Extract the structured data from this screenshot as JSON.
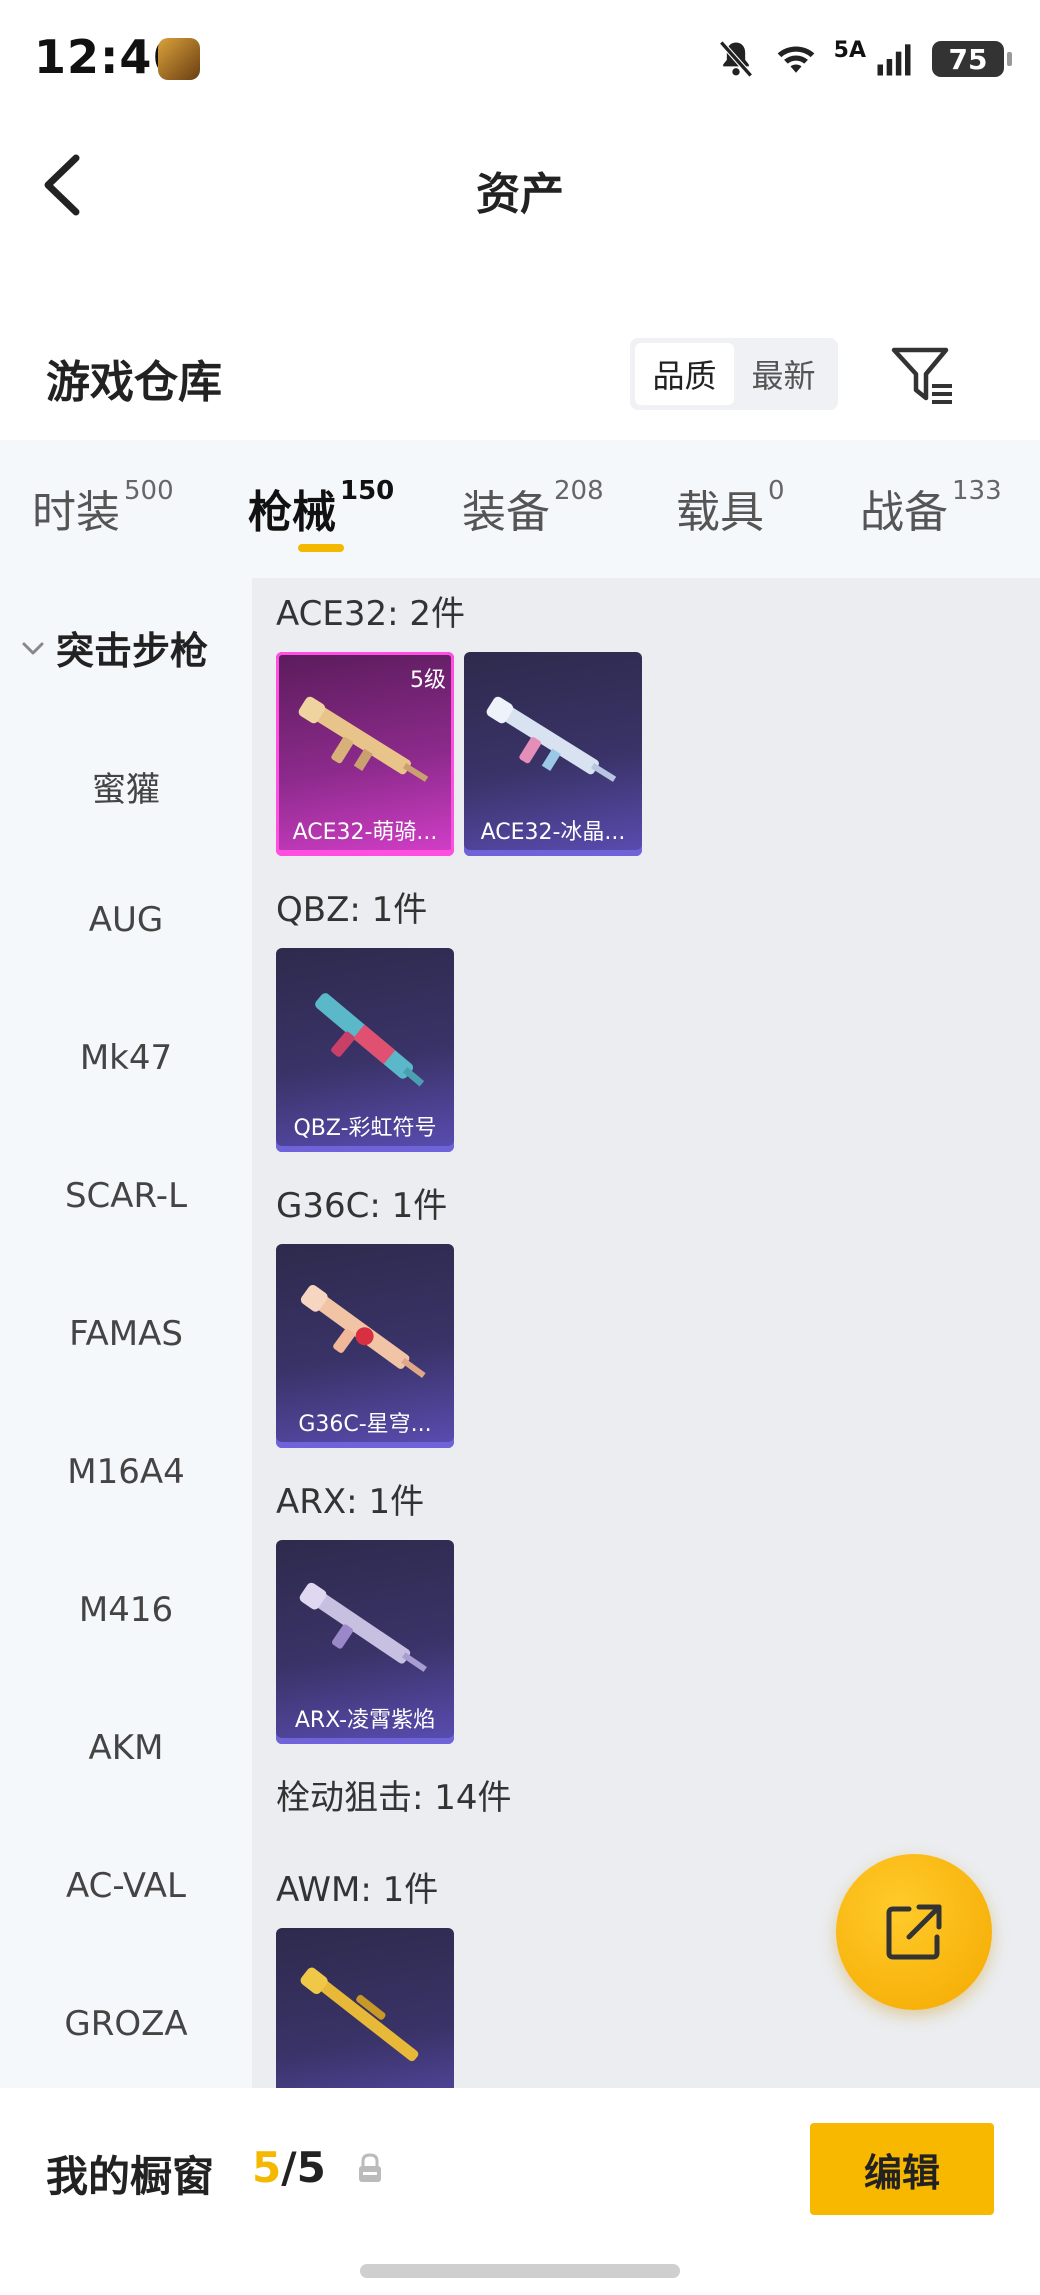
{
  "status_bar": {
    "time": "12:46",
    "network": "5A",
    "battery": "75",
    "icons": [
      "app-icon",
      "mute-icon",
      "wifi-icon",
      "signal-icon",
      "battery-icon"
    ]
  },
  "nav": {
    "title": "资产",
    "back_icon": "back-arrow-icon"
  },
  "header": {
    "title": "游戏仓库",
    "sort_options": [
      {
        "label": "品质",
        "selected": true
      },
      {
        "label": "最新",
        "selected": false
      }
    ],
    "filter_icon": "filter-icon"
  },
  "tabs": [
    {
      "label": "时装",
      "count": "500",
      "active": false
    },
    {
      "label": "枪械",
      "count": "150",
      "active": true
    },
    {
      "label": "装备",
      "count": "208",
      "active": false
    },
    {
      "label": "载具",
      "count": "0",
      "active": false
    },
    {
      "label": "战备",
      "count": "133",
      "active": false
    }
  ],
  "sidebar": {
    "group": "突击步枪",
    "items": [
      "蜜獾",
      "AUG",
      "Mk47",
      "SCAR-L",
      "FAMAS",
      "M16A4",
      "M416",
      "AKM",
      "AC-VAL",
      "GROZA"
    ]
  },
  "content": {
    "groups": [
      {
        "label": "ACE32: 2件",
        "cards": [
          {
            "name": "ACE32-萌骑...",
            "level": "5级",
            "quality": "pink"
          },
          {
            "name": "ACE32-冰晶...",
            "quality": "purple"
          }
        ]
      },
      {
        "label": "QBZ: 1件",
        "cards": [
          {
            "name": "QBZ-彩虹符号",
            "quality": "purple"
          }
        ]
      },
      {
        "label": "G36C: 1件",
        "cards": [
          {
            "name": "G36C-星穹...",
            "quality": "purple"
          }
        ]
      },
      {
        "label": "ARX: 1件",
        "cards": [
          {
            "name": "ARX-凌霄紫焰",
            "quality": "purple"
          }
        ]
      },
      {
        "label": "栓动狙击: 14件",
        "cards": []
      },
      {
        "label": "AWM: 1件",
        "cards": [
          {
            "name": "",
            "quality": "purple"
          }
        ]
      }
    ]
  },
  "fab": {
    "icon": "share-external-icon"
  },
  "bottom_bar": {
    "label": "我的橱窗",
    "count_current": "5",
    "count_sep": "/",
    "count_total": "5",
    "lock_icon": "lock-icon",
    "edit_label": "编辑"
  },
  "colors": {
    "accent": "#f5b800",
    "card_purple": "#3a3368",
    "card_pink": "#d43fc9",
    "content_bg": "#ebedf0",
    "sidebar_bg": "#f5f8fb"
  }
}
